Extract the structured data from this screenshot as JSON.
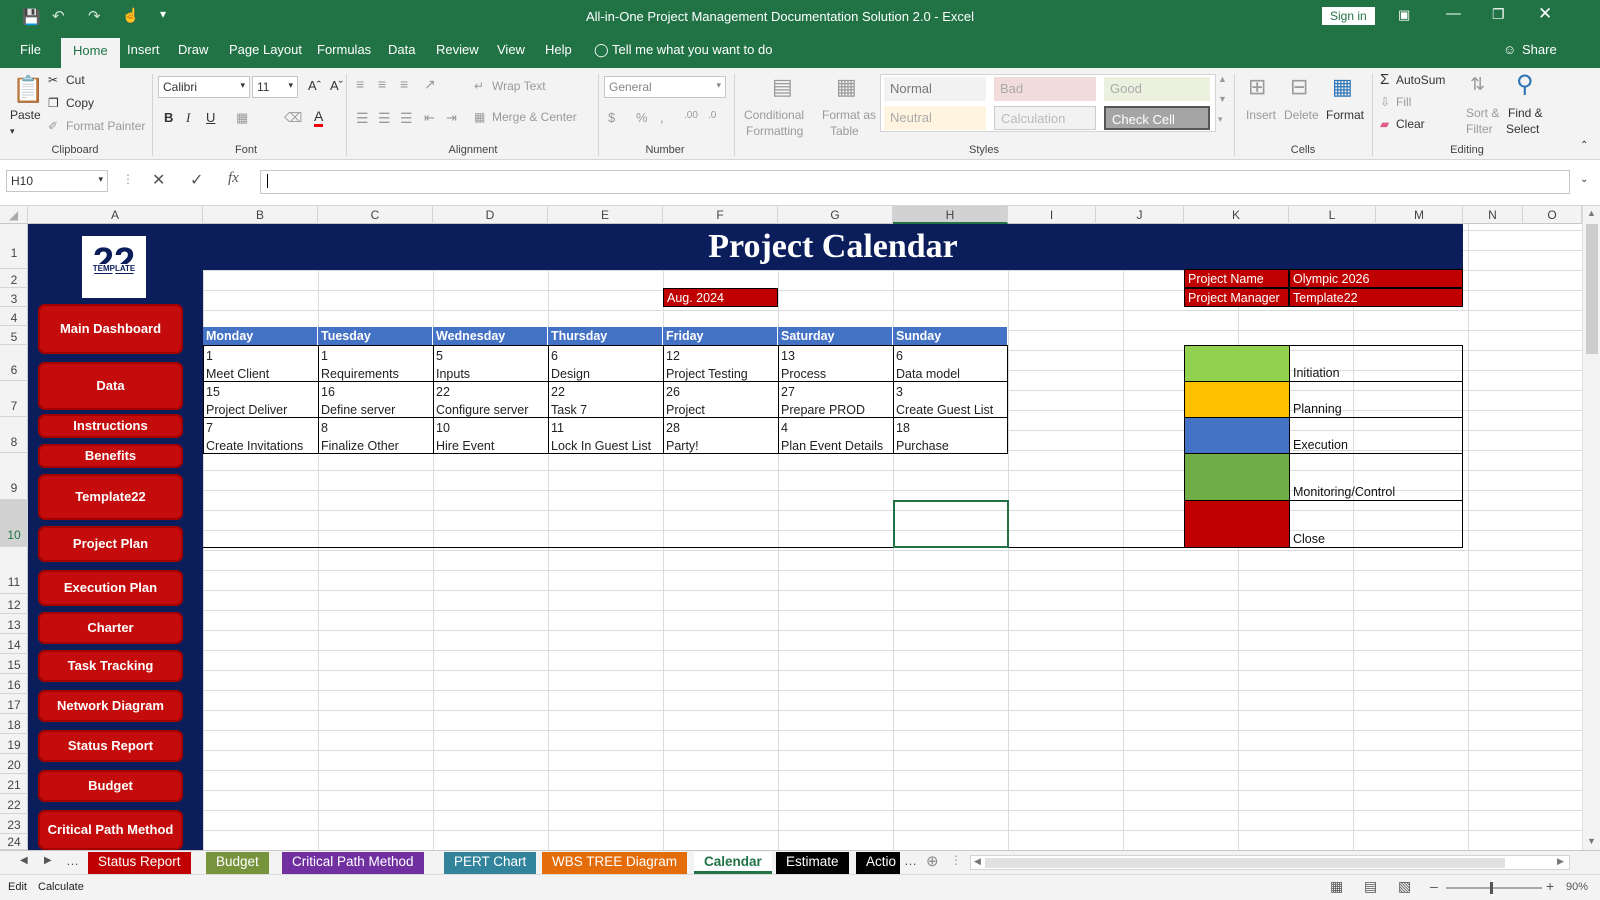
{
  "window": {
    "title": "All-in-One Project Management Documentation Solution 2.0  -  Excel",
    "sign_in": "Sign in",
    "share": "Share"
  },
  "ribbon_tabs": [
    "File",
    "Home",
    "Insert",
    "Draw",
    "Page Layout",
    "Formulas",
    "Data",
    "Review",
    "View",
    "Help"
  ],
  "tell_me": "Tell me what you want to do",
  "clipboard": {
    "paste": "Paste",
    "cut": "Cut",
    "copy": "Copy",
    "format_painter": "Format Painter",
    "label": "Clipboard"
  },
  "font": {
    "name": "Calibri",
    "size": "11",
    "label": "Font"
  },
  "alignment": {
    "wrap": "Wrap Text",
    "merge": "Merge & Center",
    "label": "Alignment"
  },
  "number": {
    "format": "General",
    "label": "Number"
  },
  "styles": {
    "conditional": "Conditional",
    "formatting": "Formatting",
    "format_as": "Format as",
    "table": "Table",
    "normal": "Normal",
    "bad": "Bad",
    "good": "Good",
    "neutral": "Neutral",
    "calculation": "Calculation",
    "check_cell": "Check Cell",
    "label": "Styles"
  },
  "cells": {
    "insert": "Insert",
    "delete": "Delete",
    "format": "Format",
    "label": "Cells"
  },
  "editing": {
    "autosum": "AutoSum",
    "fill": "Fill",
    "clear": "Clear",
    "sort": "Sort &",
    "filter": "Filter",
    "find": "Find &",
    "select": "Select",
    "label": "Editing"
  },
  "formula_bar": {
    "name_box": "H10",
    "fx": "fx",
    "value": ""
  },
  "columns": [
    "A",
    "B",
    "C",
    "D",
    "E",
    "F",
    "G",
    "H",
    "I",
    "J",
    "K",
    "L",
    "M",
    "N",
    "O"
  ],
  "rows": [
    "1",
    "2",
    "3",
    "4",
    "5",
    "6",
    "7",
    "8",
    "9",
    "10",
    "11",
    "12",
    "13",
    "14",
    "15",
    "16",
    "17",
    "18",
    "19",
    "20",
    "21",
    "22",
    "23",
    "24"
  ],
  "logo": {
    "number": "22",
    "text": "TEMPLATE"
  },
  "nav": [
    "Main Dashboard",
    "Data",
    "Instructions",
    "Benefits",
    "Template22",
    "Project Plan",
    "Execution Plan",
    "Charter",
    "Task Tracking",
    "Network Diagram",
    "Status Report",
    "Budget",
    "Critical Path Method"
  ],
  "sheet_title": "Project Calendar",
  "month": "Aug. 2024",
  "project": {
    "name_label": "Project Name",
    "name": "Olympic 2026",
    "manager_label": "Project Manager",
    "manager": "Template22"
  },
  "days": [
    "Monday",
    "Tuesday",
    "Wednesday",
    "Thursday",
    "Friday",
    "Saturday",
    "Sunday"
  ],
  "calendar": [
    [
      {
        "n": "1",
        "t": "Meet Client"
      },
      {
        "n": "1",
        "t": "Requirements"
      },
      {
        "n": "5",
        "t": "Inputs"
      },
      {
        "n": "6",
        "t": "Design"
      },
      {
        "n": "12",
        "t": "Project Testing"
      },
      {
        "n": "13",
        "t": "Process"
      },
      {
        "n": "6",
        "t": "Data model"
      }
    ],
    [
      {
        "n": "15",
        "t": "Project Deliver"
      },
      {
        "n": "16",
        "t": "Define server"
      },
      {
        "n": "22",
        "t": "Configure server"
      },
      {
        "n": "22",
        "t": "Task 7"
      },
      {
        "n": "26",
        "t": "Project"
      },
      {
        "n": "27",
        "t": "Prepare PROD"
      },
      {
        "n": "3",
        "t": "Create Guest List"
      }
    ],
    [
      {
        "n": "7",
        "t": "Create Invitations"
      },
      {
        "n": "8",
        "t": "Finalize Other"
      },
      {
        "n": "10",
        "t": "Hire Event"
      },
      {
        "n": "11",
        "t": "Lock In Guest List"
      },
      {
        "n": "28",
        "t": "Party!"
      },
      {
        "n": "4",
        "t": "Plan Event Details"
      },
      {
        "n": "18",
        "t": "Purchase"
      }
    ]
  ],
  "legend": [
    {
      "label": "Initiation",
      "color": "#92d050"
    },
    {
      "label": "Planning",
      "color": "#ffc000"
    },
    {
      "label": "Execution",
      "color": "#4472c4"
    },
    {
      "label": "Monitoring/Control",
      "color": "#70ad47"
    },
    {
      "label": "Close",
      "color": "#c00000"
    }
  ],
  "sheet_tabs": [
    {
      "label": "Status Report",
      "color": "#c00000"
    },
    {
      "label": "Budget",
      "color": "#77933c"
    },
    {
      "label": "Critical Path Method",
      "color": "#7030a0"
    },
    {
      "label": "PERT Chart",
      "color": "#31849b"
    },
    {
      "label": "WBS TREE Diagram",
      "color": "#e46c0a"
    },
    {
      "label": "Calendar",
      "color": "#ffffff"
    },
    {
      "label": "Estimate",
      "color": "#000000"
    },
    {
      "label": "Actio",
      "color": "#000000"
    }
  ],
  "status": {
    "mode": "Edit",
    "calc": "Calculate",
    "zoom": "90%"
  }
}
